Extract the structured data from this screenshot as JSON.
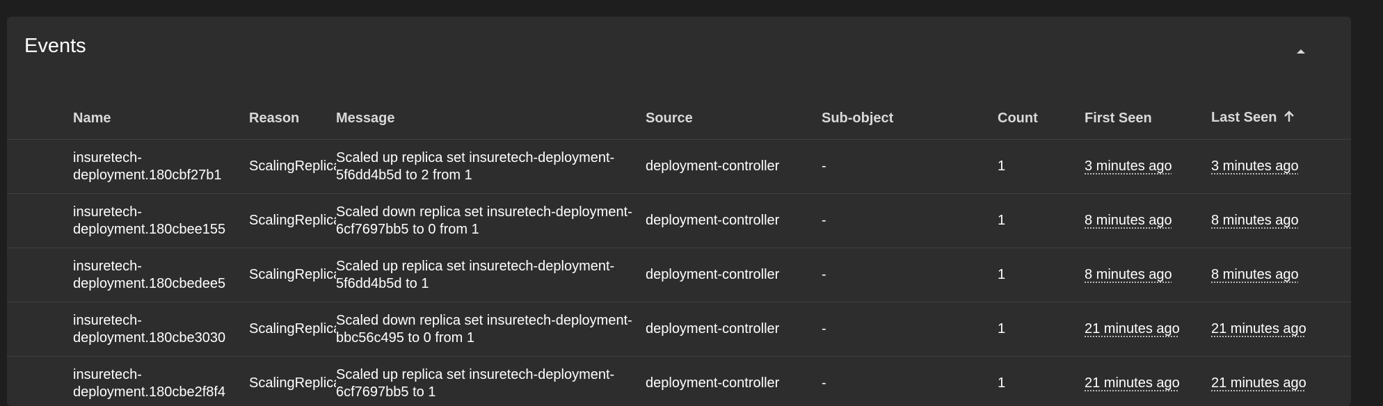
{
  "panel": {
    "title": "Events",
    "collapse_icon": "chevron-up-icon"
  },
  "table": {
    "columns": [
      {
        "key": "name",
        "label": "Name"
      },
      {
        "key": "reason",
        "label": "Reason"
      },
      {
        "key": "message",
        "label": "Message"
      },
      {
        "key": "source",
        "label": "Source"
      },
      {
        "key": "subobject",
        "label": "Sub-object"
      },
      {
        "key": "count",
        "label": "Count"
      },
      {
        "key": "first_seen",
        "label": "First Seen"
      },
      {
        "key": "last_seen",
        "label": "Last Seen"
      }
    ],
    "sort": {
      "column": "last_seen",
      "direction": "asc",
      "icon": "arrow-up-icon"
    },
    "rows": [
      {
        "name": "insuretech-deployment.180cbf27b1",
        "reason": "ScalingReplicaSet",
        "message": "Scaled up replica set insuretech-deployment-5f6dd4b5d to 2 from 1",
        "source": "deployment-controller",
        "subobject": "-",
        "count": "1",
        "first_seen": "3 minutes ago",
        "last_seen": "3 minutes ago"
      },
      {
        "name": "insuretech-deployment.180cbee155",
        "reason": "ScalingReplicaSet",
        "message": "Scaled down replica set insuretech-deployment-6cf7697bb5 to 0 from 1",
        "source": "deployment-controller",
        "subobject": "-",
        "count": "1",
        "first_seen": "8 minutes ago",
        "last_seen": "8 minutes ago"
      },
      {
        "name": "insuretech-deployment.180cbedee5",
        "reason": "ScalingReplicaSet",
        "message": "Scaled up replica set insuretech-deployment-5f6dd4b5d to 1",
        "source": "deployment-controller",
        "subobject": "-",
        "count": "1",
        "first_seen": "8 minutes ago",
        "last_seen": "8 minutes ago"
      },
      {
        "name": "insuretech-deployment.180cbe3030",
        "reason": "ScalingReplicaSet",
        "message": "Scaled down replica set insuretech-deployment-bbc56c495 to 0 from 1",
        "source": "deployment-controller",
        "subobject": "-",
        "count": "1",
        "first_seen": "21 minutes ago",
        "last_seen": "21 minutes ago"
      },
      {
        "name": "insuretech-deployment.180cbe2f8f4",
        "reason": "ScalingReplicaSet",
        "message": "Scaled up replica set insuretech-deployment-6cf7697bb5 to 1",
        "source": "deployment-controller",
        "subobject": "-",
        "count": "1",
        "first_seen": "21 minutes ago",
        "last_seen": "21 minutes ago"
      }
    ]
  }
}
